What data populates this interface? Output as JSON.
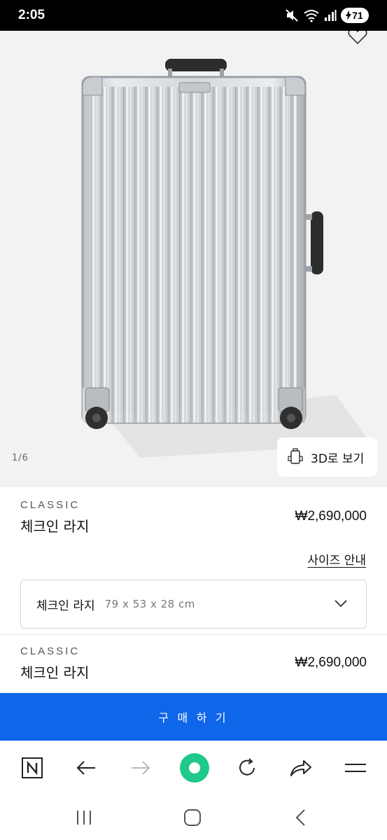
{
  "status_bar": {
    "time": "2:05",
    "battery": "71"
  },
  "gallery": {
    "counter": "1/6",
    "view_3d_label": "3D로 보기"
  },
  "product_main": {
    "brand": "CLASSIC",
    "name": "체크인 라지",
    "price": "₩2,690,000"
  },
  "size_guide_label": "사이즈 안내",
  "size_select": {
    "name": "체크인 라지",
    "dimensions": "79 x 53 x 28 cm"
  },
  "product_sticky": {
    "brand": "CLASSIC",
    "name": "체크인 라지",
    "price": "₩2,690,000"
  },
  "buy_button_label": "구 매 하 기",
  "browser_bar": {
    "icons": [
      "naver-home-icon",
      "back-arrow-icon",
      "forward-arrow-icon",
      "green-dot-icon",
      "refresh-icon",
      "share-icon",
      "menu-icon"
    ]
  },
  "system_nav": {
    "icons": [
      "recent-apps-icon",
      "home-icon",
      "back-icon"
    ]
  },
  "colors": {
    "buy_button": "#0f66e9",
    "green_dot": "#1ec98a"
  }
}
